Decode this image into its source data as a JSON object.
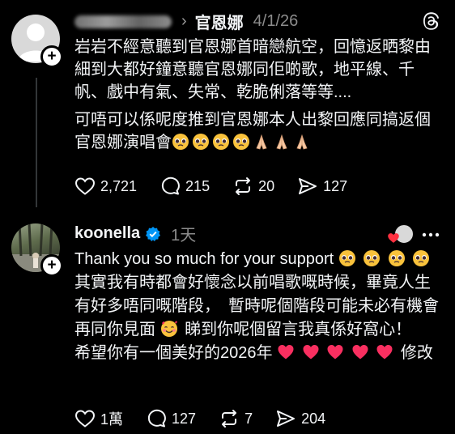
{
  "post1": {
    "reply_to": "官恩娜",
    "date": "4/1/26",
    "paragraphs": [
      "岩岩不經意聽到官恩娜首暗戀航空，回憶返晒黎由細到大都好鐘意聽官恩娜同佢啲歌，地平線、千帆、戲中有氣、失常、乾脆俐落等等....",
      "可唔可以係呢度推到官恩娜本人出黎回應同搞返個官恩娜演唱會"
    ],
    "emoji_tail": [
      "pleading-face",
      "pleading-face",
      "pleading-face",
      "pleading-face",
      "folded-hands",
      "folded-hands",
      "folded-hands"
    ],
    "stats": {
      "likes": "2,721",
      "comments": "215",
      "reposts": "20",
      "shares": "127"
    }
  },
  "post2": {
    "username": "koonella",
    "verified": true,
    "time": "1天",
    "line1": "Thank you so much for your support",
    "line2": "其實我有時都會好懷念以前唱歌嘅時候，畢竟人生有好多唔同嘅階段，　暫時呢個階段可能未必有機會再同你見面",
    "line3": "睇到你呢個留言我真係好窩心！　希望你有一個美好的2026年",
    "line4": "修改",
    "stats": {
      "likes": "1萬",
      "comments": "127",
      "reposts": "7",
      "shares": "204"
    }
  },
  "icons": [
    "threads-logo-icon",
    "more-icon",
    "verified-badge-icon",
    "heart-icon",
    "comment-icon",
    "repost-icon",
    "share-icon",
    "plus-icon"
  ],
  "colors": {
    "background": "#000000",
    "text": "#f3f5f7",
    "muted": "#8c8c8c",
    "verified": "#0095f6",
    "heart": "#ff3040"
  }
}
